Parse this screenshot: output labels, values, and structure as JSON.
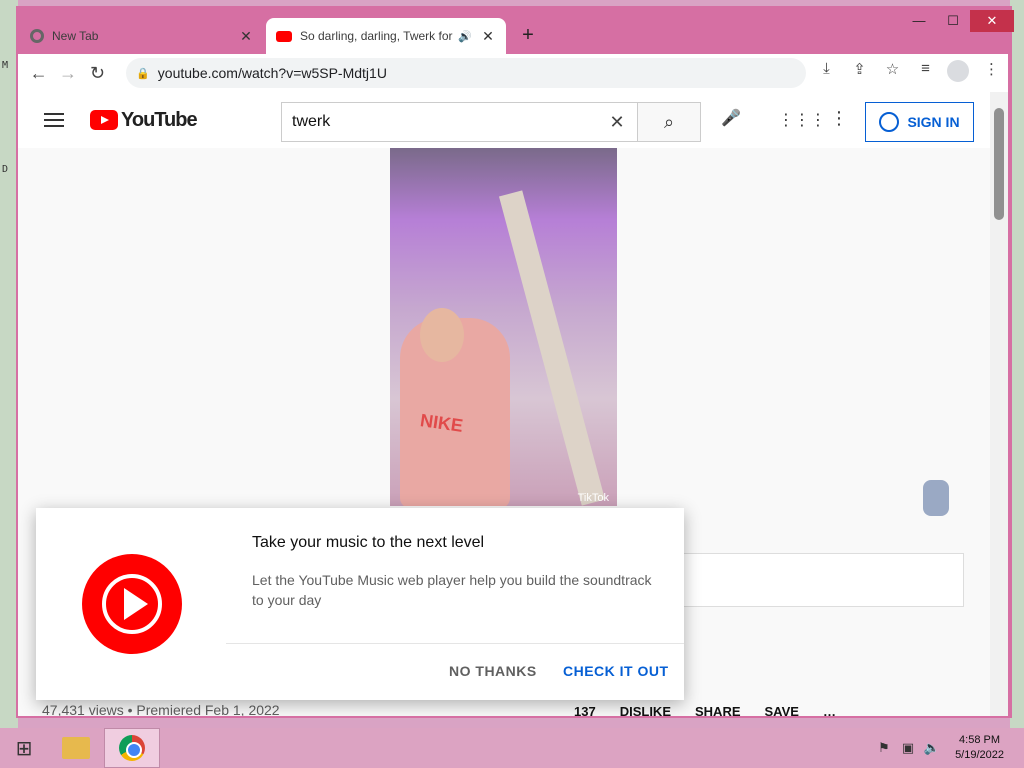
{
  "desktop": {
    "left_glyph_1": "M",
    "left_glyph_2": "D"
  },
  "browser": {
    "tabs": [
      {
        "title": "New Tab"
      },
      {
        "title": "So darling, darling, Twerk for"
      }
    ],
    "new_tab_symbol": "+",
    "window_controls": {
      "minimize": "—",
      "maximize": "☐",
      "close": "✕"
    },
    "url": "youtube.com/watch?v=w5SP-Mdtj1U"
  },
  "youtube": {
    "logo_text": "YouTube",
    "search_value": "twerk",
    "signin_label": "SIGN IN",
    "video_watermark": "TikTok",
    "meta": "47,431 views • Premiered Feb 1, 2022",
    "actions": [
      "137",
      "DISLIKE",
      "SHARE",
      "SAVE",
      "…"
    ]
  },
  "dialog": {
    "title": "Take your music to the next level",
    "body": "Let the YouTube Music web player help you build the soundtrack to your day",
    "no_label": "NO THANKS",
    "yes_label": "CHECK IT OUT"
  },
  "taskbar": {
    "time": "4:58 PM",
    "date": "5/19/2022"
  }
}
